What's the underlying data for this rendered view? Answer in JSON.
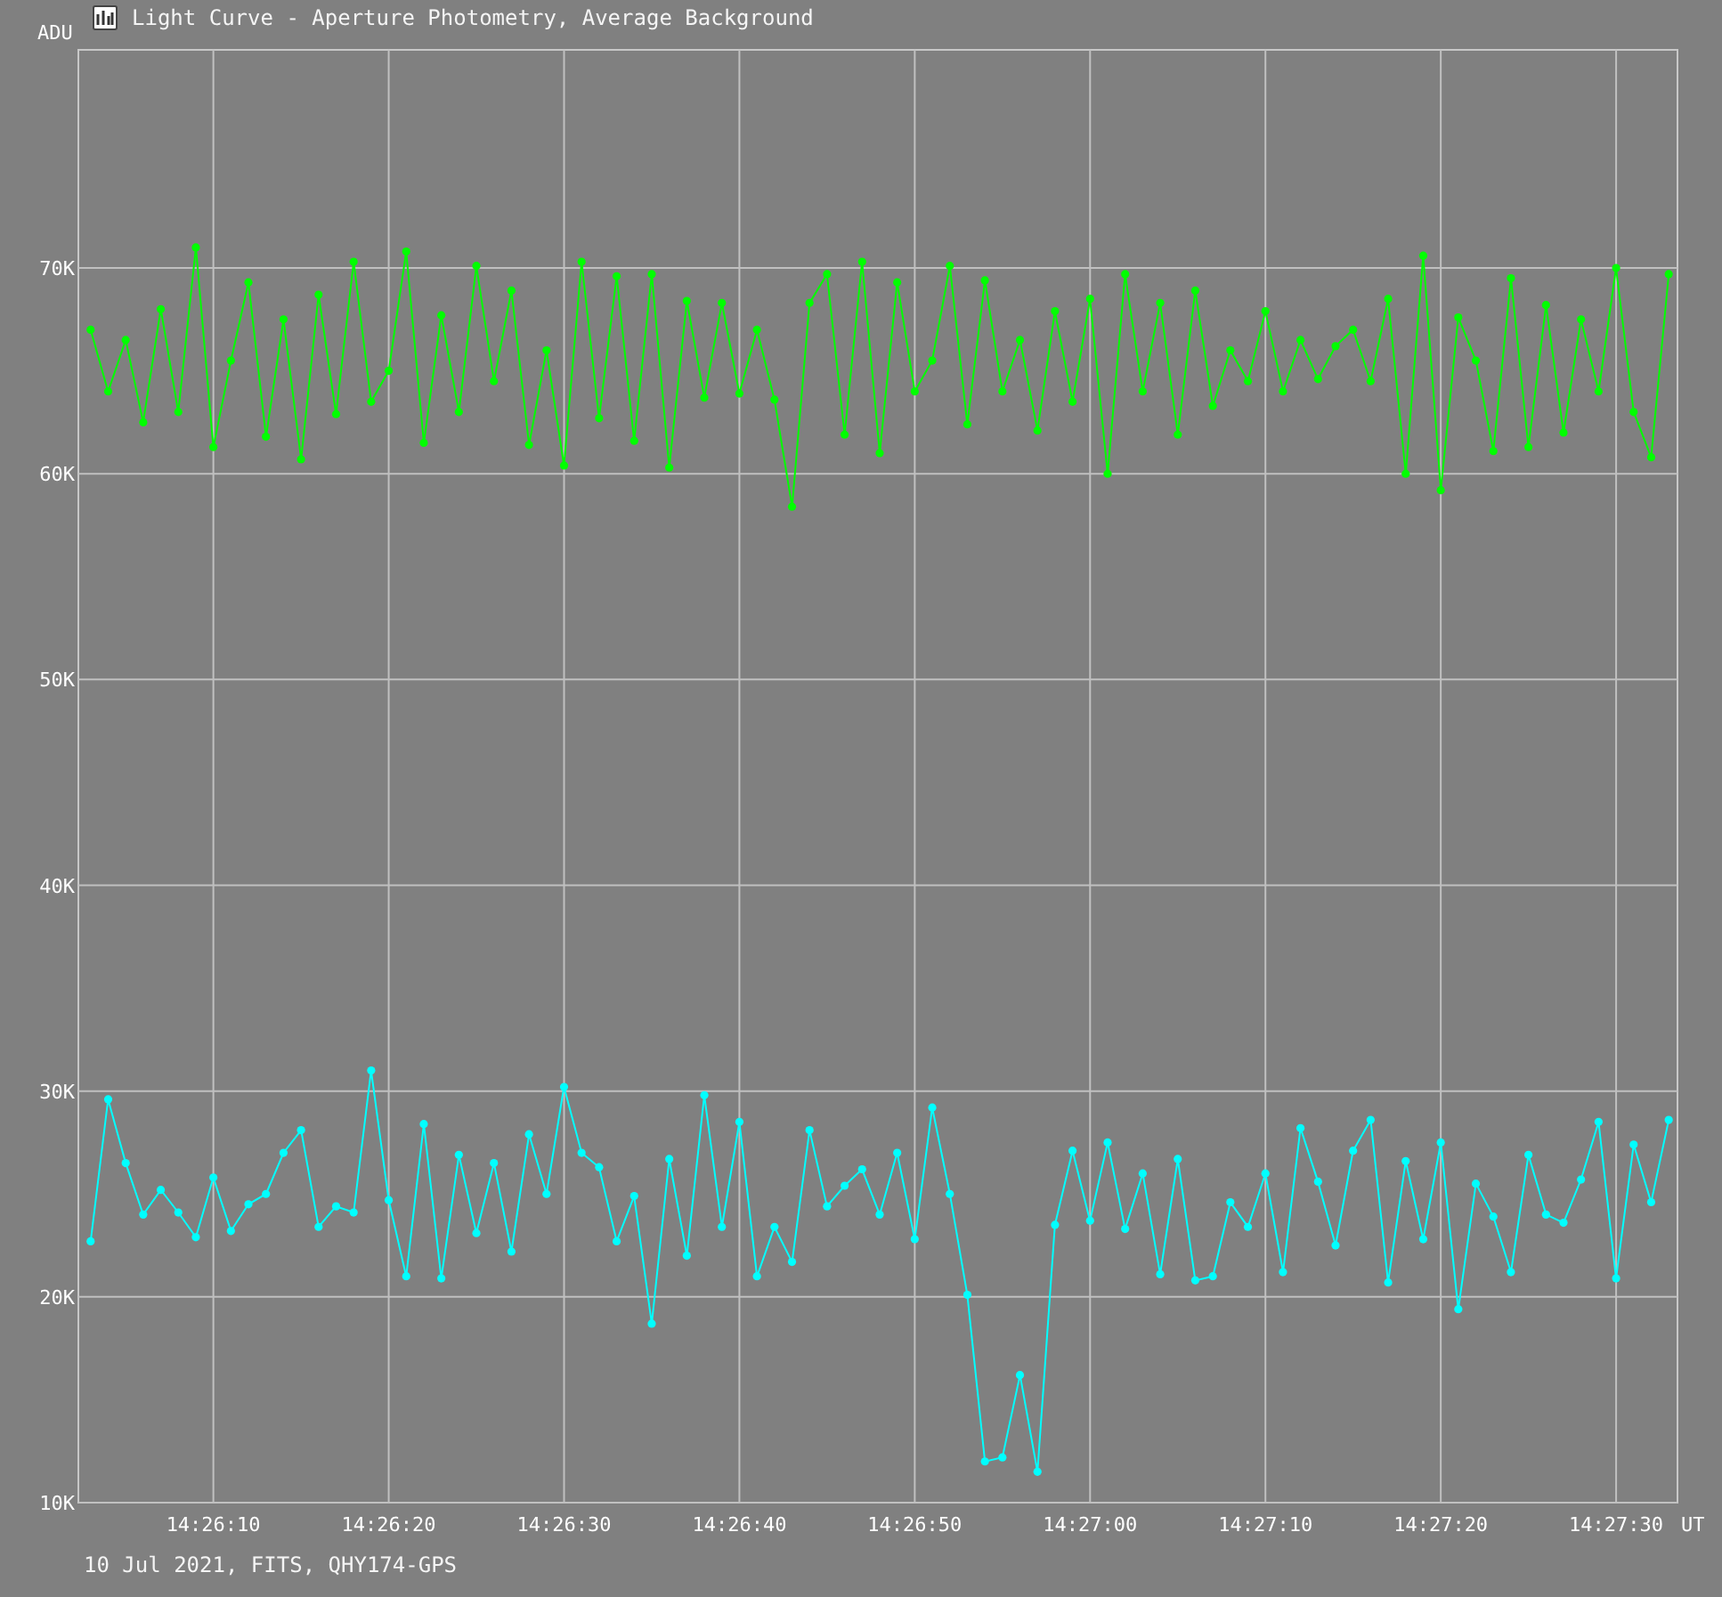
{
  "window": {
    "title": "Light Curve - Aperture Photometry, Average Background"
  },
  "chart": {
    "chart_data": {
      "type": "line",
      "grid": true,
      "ylabel": "ADU",
      "xlabel": "UT",
      "categories": [
        null,
        null,
        null,
        null,
        null,
        null,
        null,
        "14:26:10",
        null,
        null,
        null,
        null,
        null,
        null,
        null,
        null,
        null,
        "14:26:20",
        null,
        null,
        null,
        null,
        null,
        null,
        null,
        null,
        null,
        "14:26:30",
        null,
        null,
        null,
        null,
        null,
        null,
        null,
        null,
        null,
        "14:26:40",
        null,
        null,
        null,
        null,
        null,
        null,
        null,
        null,
        null,
        "14:26:50",
        null,
        null,
        null,
        null,
        null,
        null,
        null,
        null,
        null,
        "14:27:00",
        null,
        null,
        null,
        null,
        null,
        null,
        null,
        null,
        null,
        "14:27:10",
        null,
        null,
        null,
        null,
        null,
        null,
        null,
        null,
        null,
        "14:27:20",
        null,
        null,
        null,
        null,
        null,
        null,
        null,
        null,
        null,
        "14:27:30",
        null,
        null,
        null
      ],
      "series": [
        {
          "color": "#00ff00",
          "marker": "circle",
          "values": [
            67000,
            64000,
            66500,
            62500,
            68000,
            63000,
            71000,
            61300,
            65500,
            69300,
            61800,
            67500,
            60700,
            68700,
            62900,
            70300,
            63500,
            65000,
            70800,
            61500,
            67700,
            63000,
            70100,
            64500,
            68900,
            61400,
            66000,
            60400,
            70300,
            62700,
            69600,
            61600,
            69700,
            60300,
            68400,
            63700,
            68300,
            63900,
            67000,
            63600,
            58400,
            68300,
            69700,
            61900,
            70300,
            61000,
            69300,
            64000,
            65500,
            70100,
            62400,
            69400,
            64000,
            66500,
            62100,
            67900,
            63500,
            68500,
            60000,
            69700,
            64000,
            68300,
            61900,
            68900,
            63300,
            66000,
            64500,
            67900,
            64000,
            66500,
            64600,
            66200,
            67000,
            64500,
            68500,
            60000,
            70600,
            59200,
            67600,
            65500,
            61100,
            69500,
            61300,
            68200,
            62000,
            67500,
            64000,
            70000,
            63000,
            60800,
            69700
          ]
        },
        {
          "color": "#00ffff",
          "marker": "circle",
          "values": [
            22700,
            29600,
            26500,
            24000,
            25200,
            24100,
            22900,
            25800,
            23200,
            24500,
            25000,
            27000,
            28100,
            23400,
            24400,
            24100,
            31000,
            24700,
            21000,
            28400,
            20900,
            26900,
            23100,
            26500,
            22200,
            27900,
            25000,
            30200,
            27000,
            26300,
            22700,
            24900,
            18700,
            26700,
            22000,
            29800,
            23400,
            28500,
            21000,
            23400,
            21700,
            28100,
            24400,
            25400,
            26200,
            24000,
            27000,
            22800,
            29200,
            25000,
            20100,
            12000,
            12200,
            16200,
            11500,
            23500,
            27100,
            23700,
            27500,
            23300,
            26000,
            21100,
            26700,
            20800,
            21000,
            24600,
            23400,
            26000,
            21200,
            28200,
            25600,
            22500,
            27100,
            28600,
            20700,
            26600,
            22800,
            27500,
            19400,
            25500,
            23900,
            21200,
            26900,
            24000,
            23600,
            25700,
            28500,
            20900,
            27400,
            24600,
            28600
          ]
        }
      ],
      "ylim": [
        10000,
        80600
      ],
      "yticks": [
        {
          "value": 10000,
          "label": "10K"
        },
        {
          "value": 20000,
          "label": "20K"
        },
        {
          "value": 30000,
          "label": "30K"
        },
        {
          "value": 40000,
          "label": "40K"
        },
        {
          "value": 50000,
          "label": "50K"
        },
        {
          "value": 60000,
          "label": "60K"
        },
        {
          "value": 70000,
          "label": "70K"
        }
      ]
    }
  },
  "status_bar": {
    "text": "10 Jul 2021, FITS, QHY174-GPS"
  }
}
